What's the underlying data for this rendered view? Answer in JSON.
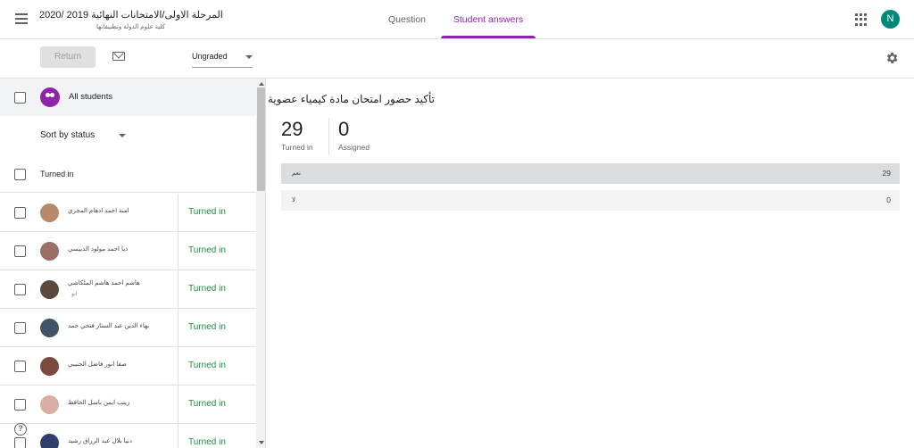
{
  "header": {
    "class_title": "المرحلة الاولى/الامتحانات النهائية 2019 /2020",
    "class_subtitle": "كلية علوم الدولة وتطبيقاتها",
    "tabs": [
      {
        "label": "Question",
        "active": false
      },
      {
        "label": "Student answers",
        "active": true
      }
    ],
    "avatar_initial": "N",
    "accent_color": "#8e24aa",
    "avatar_color": "#00897b"
  },
  "toolbar": {
    "return_label": "Return",
    "grade_select_value": "Ungraded"
  },
  "sidebar": {
    "all_students_label": "All students",
    "sort_label": "Sort by status",
    "section_label": "Turned in",
    "students": [
      {
        "name": "امنة احمد ادهام المجري",
        "sub": "",
        "status": "Turned in",
        "avatar_color": "#b78a6c"
      },
      {
        "name": "ذيا احمد مولود الدبيسي",
        "sub": "",
        "status": "Turned in",
        "avatar_color": "#9c6f66"
      },
      {
        "name": "هاشم احمد هاشم الملكاشي",
        "sub": "ابو",
        "status": "Turned in",
        "avatar_color": "#5a4a3e"
      },
      {
        "name": "بهاء الدين عبد الستار فتحي حمد",
        "sub": "",
        "status": "Turned in",
        "avatar_color": "#3f5566"
      },
      {
        "name": "صفا انور فاضل الجنيبي",
        "sub": "",
        "status": "Turned in",
        "avatar_color": "#7a4b3c"
      },
      {
        "name": "زينب ايمن باسل الحافظ",
        "sub": "",
        "status": "Turned in",
        "avatar_color": "#d9aea2"
      },
      {
        "name": "دنيا بلال عبد الرزاق رشيد",
        "sub": "",
        "status": "Turned in",
        "avatar_color": "#2f3f6b"
      }
    ]
  },
  "question": {
    "text": "تأكيد حضور امتحان مادة كيمياء عضوية",
    "turned_in_count": "29",
    "turned_in_label": "Turned in",
    "assigned_count": "0",
    "assigned_label": "Assigned",
    "answers": [
      {
        "option": "نعم",
        "count": "29",
        "fraction": 1.0
      },
      {
        "option": "لا",
        "count": "0",
        "fraction": 0.0
      }
    ]
  },
  "icons": [
    "menu-icon",
    "apps-icon",
    "mail-icon",
    "settings-icon",
    "group-icon",
    "help-icon"
  ]
}
